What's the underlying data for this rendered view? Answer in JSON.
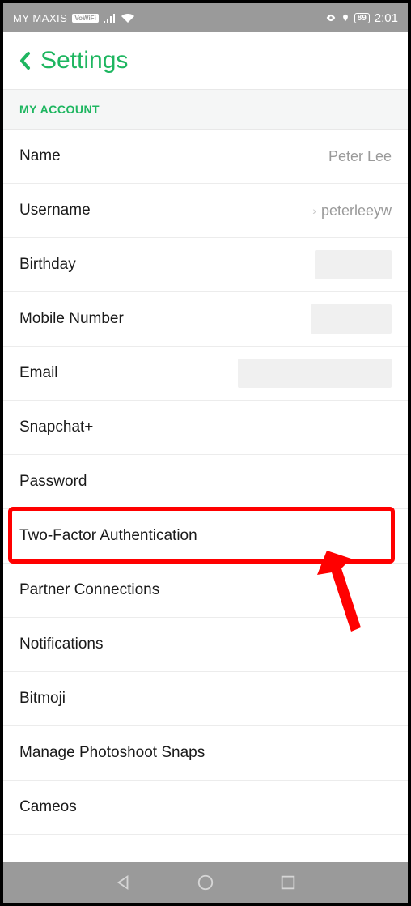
{
  "status_bar": {
    "carrier": "MY MAXIS",
    "vowifi": "VoWiFi",
    "battery": "89",
    "time": "2:01"
  },
  "header": {
    "title": "Settings"
  },
  "section": {
    "label": "MY ACCOUNT"
  },
  "rows": {
    "name": {
      "label": "Name",
      "value": "Peter Lee"
    },
    "username": {
      "label": "Username",
      "value": "peterleeyw"
    },
    "birthday": {
      "label": "Birthday"
    },
    "mobile": {
      "label": "Mobile Number"
    },
    "email": {
      "label": "Email"
    },
    "snapchat_plus": {
      "label": "Snapchat+"
    },
    "password": {
      "label": "Password"
    },
    "two_factor": {
      "label": "Two-Factor Authentication"
    },
    "partner": {
      "label": "Partner Connections"
    },
    "notifications": {
      "label": "Notifications"
    },
    "bitmoji": {
      "label": "Bitmoji"
    },
    "photoshoot": {
      "label": "Manage Photoshoot Snaps"
    },
    "cameos": {
      "label": "Cameos"
    }
  },
  "annotation": {
    "highlight_target": "two_factor"
  }
}
